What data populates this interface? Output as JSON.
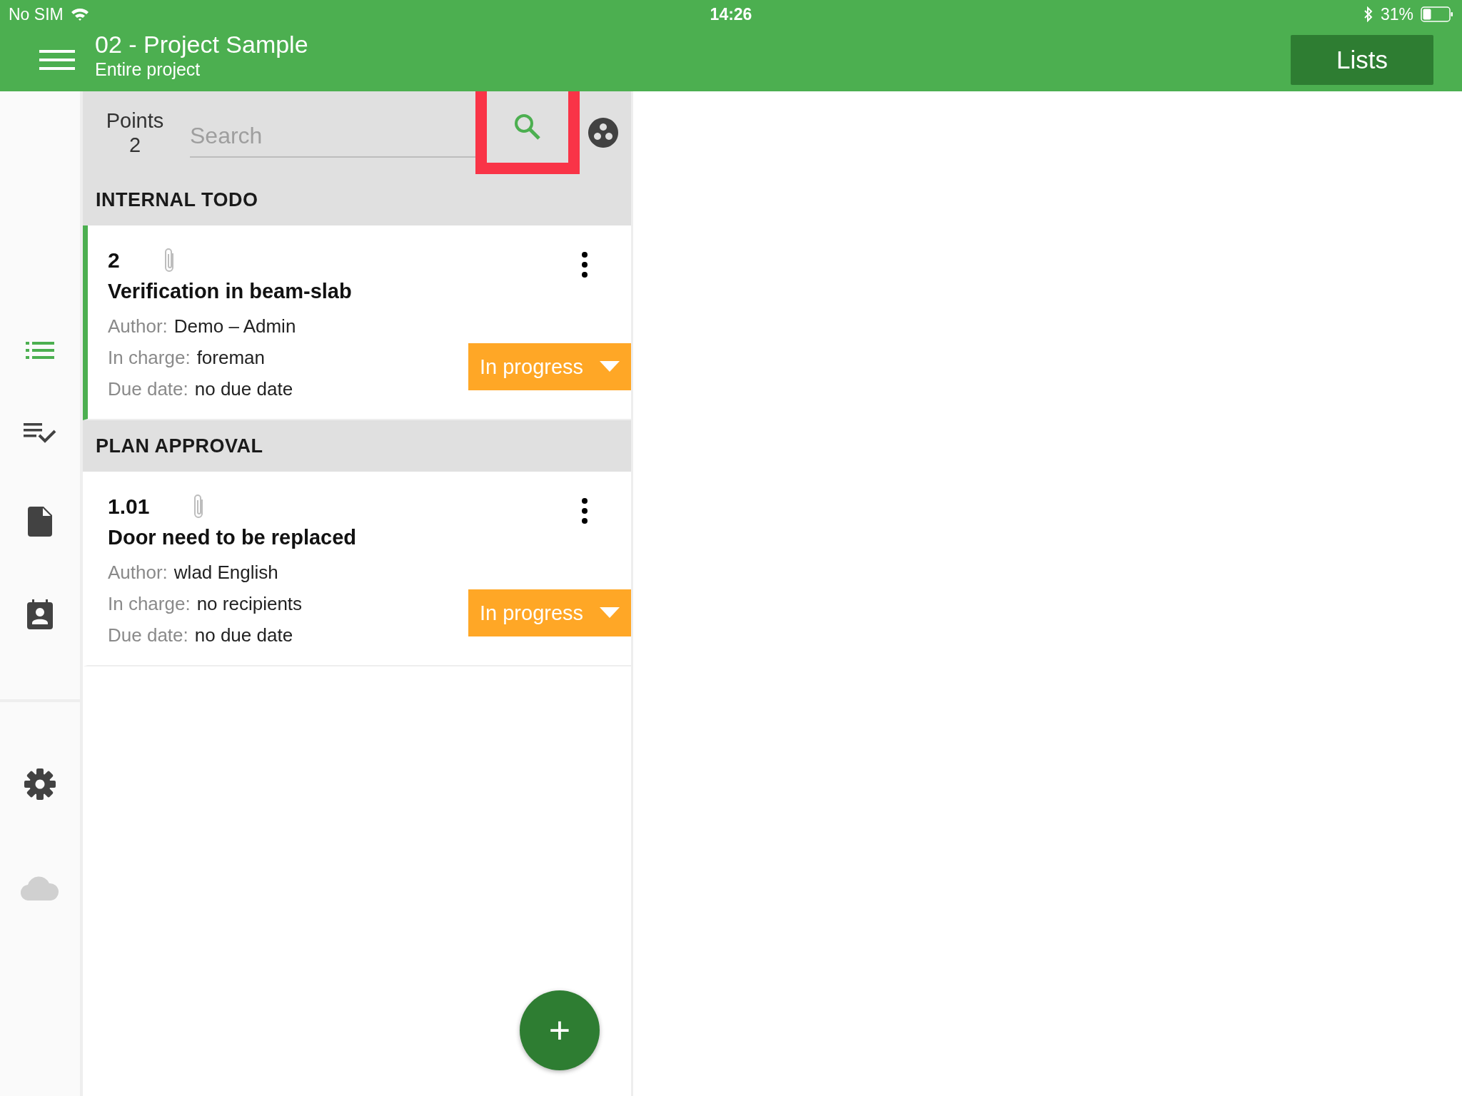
{
  "status_bar": {
    "carrier": "No SIM",
    "time": "14:26",
    "battery": "31%"
  },
  "header": {
    "title": "02 - Project Sample",
    "subtitle": "Entire project",
    "button": "Lists"
  },
  "sidebar": {
    "items": [
      {
        "kind": "list",
        "selected": true
      },
      {
        "kind": "checklist",
        "selected": false
      },
      {
        "kind": "document",
        "selected": false
      },
      {
        "kind": "contact",
        "selected": false
      }
    ],
    "bottom_items": [
      {
        "kind": "settings",
        "enabled": true
      },
      {
        "kind": "cloud",
        "enabled": false
      }
    ]
  },
  "toolbar": {
    "points_label": "Points",
    "points_count": "2",
    "search": {
      "placeholder": "Search"
    },
    "search_highlighted": true
  },
  "groups": [
    {
      "title": "INTERNAL TODO",
      "points": [
        {
          "number": "2",
          "title": "Verification in beam-slab",
          "selected": true,
          "fields": [
            {
              "label": "Author:",
              "value": "Demo – Admin"
            },
            {
              "label": "In charge:",
              "value": "foreman"
            },
            {
              "label": "Due date:",
              "value": "no due date"
            }
          ],
          "status": "In progress"
        }
      ]
    },
    {
      "title": "PLAN APPROVAL",
      "points": [
        {
          "number": "1.01",
          "title": "Door need to be replaced",
          "selected": false,
          "fields": [
            {
              "label": "Author:",
              "value": "wlad English"
            },
            {
              "label": "In charge:",
              "value": "no recipients"
            },
            {
              "label": "Due date:",
              "value": "no due date"
            }
          ],
          "status": "In progress"
        }
      ]
    }
  ],
  "fab": {
    "label": "+"
  }
}
